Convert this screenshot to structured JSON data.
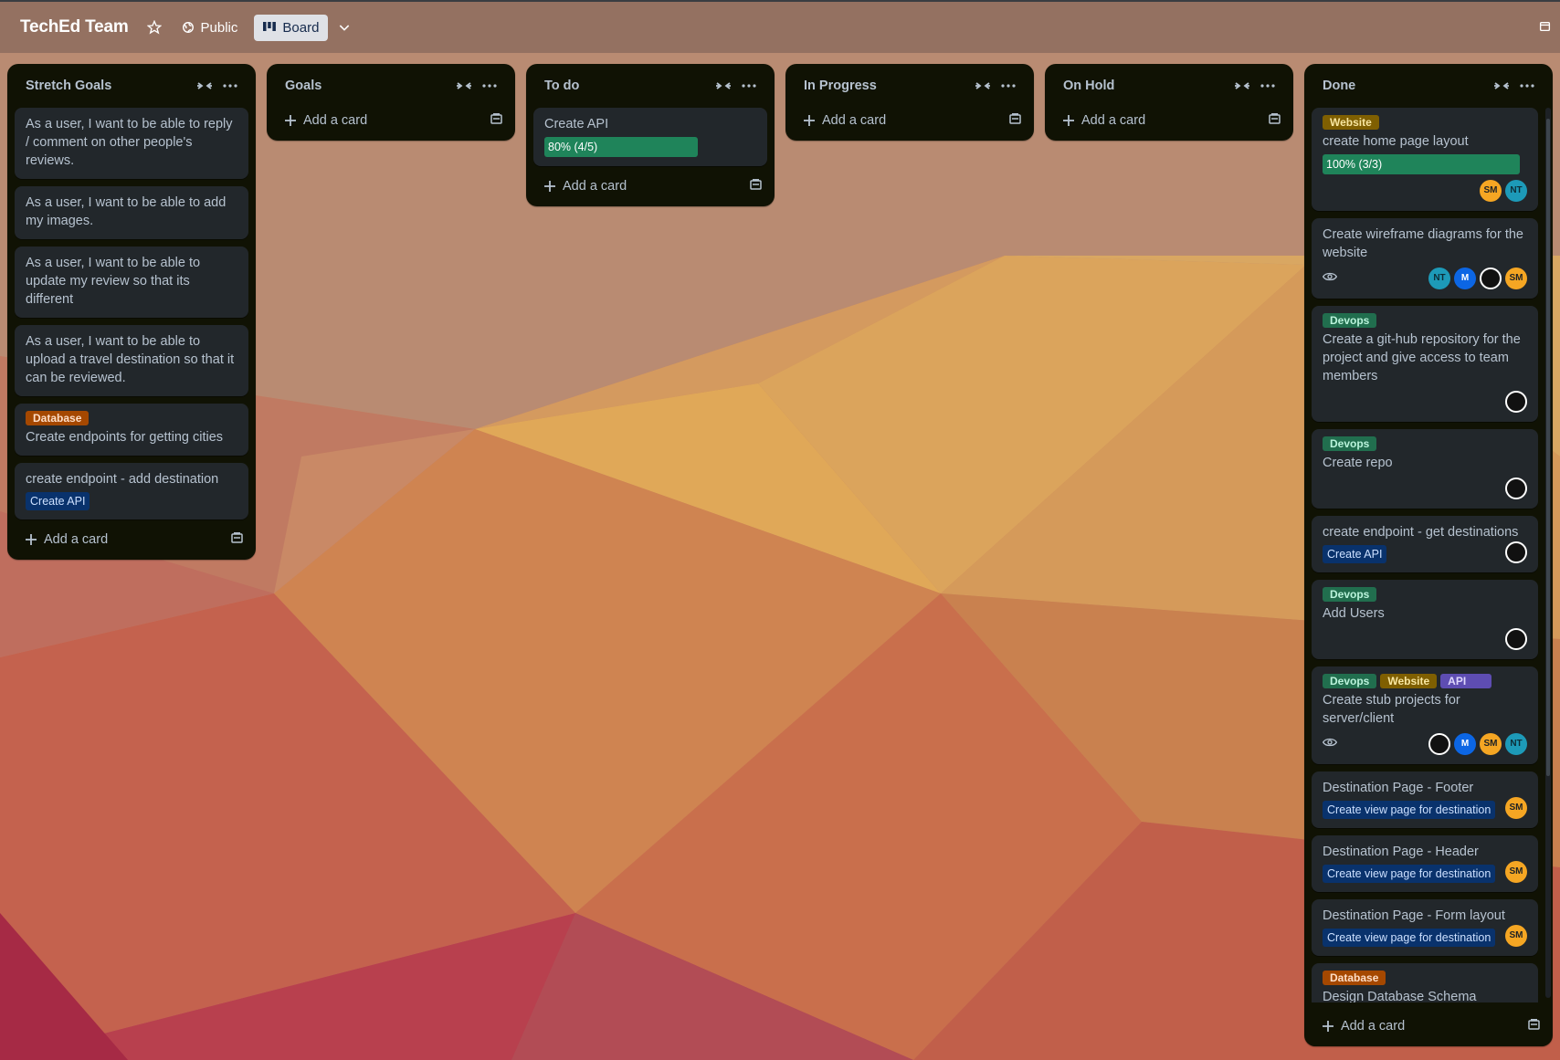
{
  "header": {
    "board_title": "TechEd Team",
    "visibility_label": "Public",
    "view_label": "Board"
  },
  "lists": [
    {
      "title": "Stretch Goals",
      "add_card_label": "Add a card",
      "cards": [
        {
          "text": "As a user, I want to be able to reply / comment on other people's reviews."
        },
        {
          "text": "As a user, I want to be able to add my images."
        },
        {
          "text": "As a user, I want to be able to update my review so that its different"
        },
        {
          "text": "As a user, I want to be able to upload a travel destination so that it can be reviewed."
        },
        {
          "label": "Database",
          "text": "Create endpoints for getting cities"
        },
        {
          "text": "create endpoint - add destination",
          "parent": "Create API"
        }
      ]
    },
    {
      "title": "Goals",
      "add_card_label": "Add a card",
      "cards": []
    },
    {
      "title": "To do",
      "add_card_label": "Add a card",
      "cards": [
        {
          "text": "Create API",
          "progress_text": "80% (4/5)",
          "progress": 0.8
        }
      ]
    },
    {
      "title": "In Progress",
      "add_card_label": "Add a card",
      "cards": []
    },
    {
      "title": "On Hold",
      "add_card_label": "Add a card",
      "cards": []
    },
    {
      "title": "Done",
      "add_card_label": "Add a card",
      "cards": [
        {
          "labels": [
            "Website"
          ],
          "text": "create home page layout",
          "progress_text": "100% (3/3)",
          "progress": 1.0,
          "members": [
            "SM",
            "NT"
          ]
        },
        {
          "text": "Create wireframe diagrams for the website",
          "watching": true,
          "members": [
            "NT",
            "M",
            "IMG",
            "SM"
          ]
        },
        {
          "labels": [
            "Devops"
          ],
          "text": "Create a git-hub repository for the project and give access to team members",
          "members": [
            "IMG"
          ]
        },
        {
          "labels": [
            "Devops"
          ],
          "text": "Create repo",
          "members": [
            "IMG"
          ]
        },
        {
          "text": "create endpoint - get destinations",
          "parent": "Create API",
          "members": [
            "IMG"
          ]
        },
        {
          "labels": [
            "Devops"
          ],
          "text": "Add Users",
          "members": [
            "IMG"
          ]
        },
        {
          "labels": [
            "Devops",
            "Website",
            "API"
          ],
          "text": "Create stub projects for server/client",
          "watching": true,
          "members": [
            "IMG",
            "M",
            "SM",
            "NT"
          ]
        },
        {
          "text": "Destination Page - Footer",
          "parent": "Create view page for destination",
          "members": [
            "SM"
          ]
        },
        {
          "text": "Destination Page - Header",
          "parent": "Create view page for destination",
          "members": [
            "SM"
          ]
        },
        {
          "text": "Destination Page - Form layout",
          "parent": "Create view page for destination",
          "members": [
            "SM"
          ]
        },
        {
          "labels": [
            "Database"
          ],
          "text": "Design Database Schema"
        }
      ]
    }
  ],
  "label_colors": {
    "Website": "#7f5f01",
    "Devops": "#216e4e",
    "Database": "#a54800",
    "API": "#5e4db2"
  },
  "accent": {
    "progress_bar": "#1f845a",
    "parent_badge": "#09326c",
    "list_bg": "#101204",
    "card_bg": "#22272b"
  },
  "icons": {
    "star": "star-icon",
    "globe": "globe-icon",
    "board": "board-icon",
    "collapse": "collapse-icon",
    "more": "ellipsis-icon",
    "plus": "plus-icon",
    "template": "template-icon",
    "eye": "eye-icon"
  }
}
